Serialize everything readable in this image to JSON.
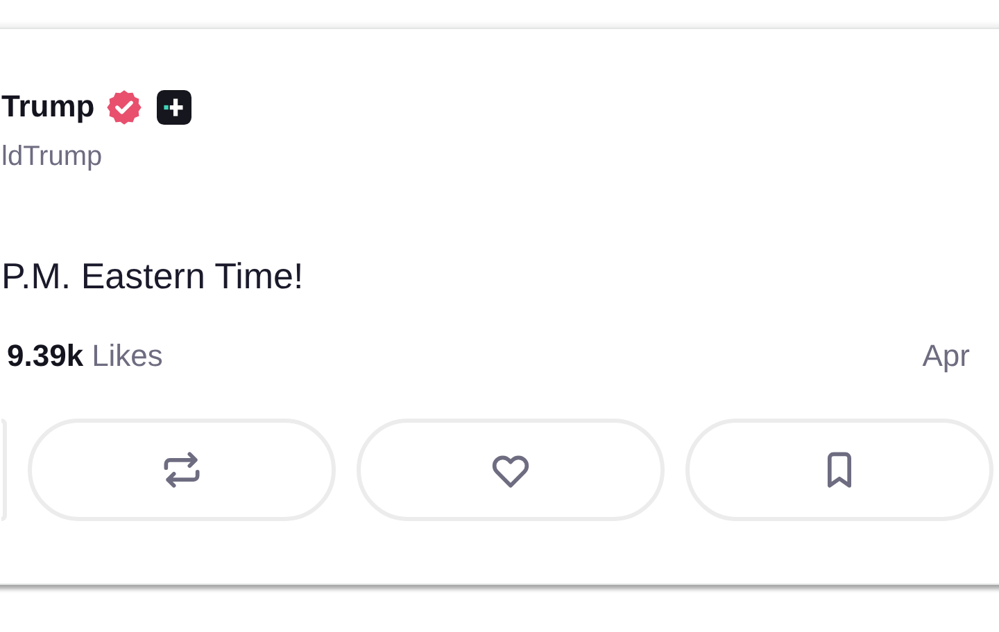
{
  "author": {
    "name": "Trump",
    "handle": "ldTrump",
    "verified": true
  },
  "post": {
    "text": "P.M. Eastern Time!"
  },
  "stats": {
    "likes_count": "9.39k",
    "likes_label": "Likes",
    "date": "Apr"
  },
  "actions": [
    {
      "kind": "partial"
    },
    {
      "kind": "repost"
    },
    {
      "kind": "like"
    },
    {
      "kind": "bookmark"
    }
  ]
}
